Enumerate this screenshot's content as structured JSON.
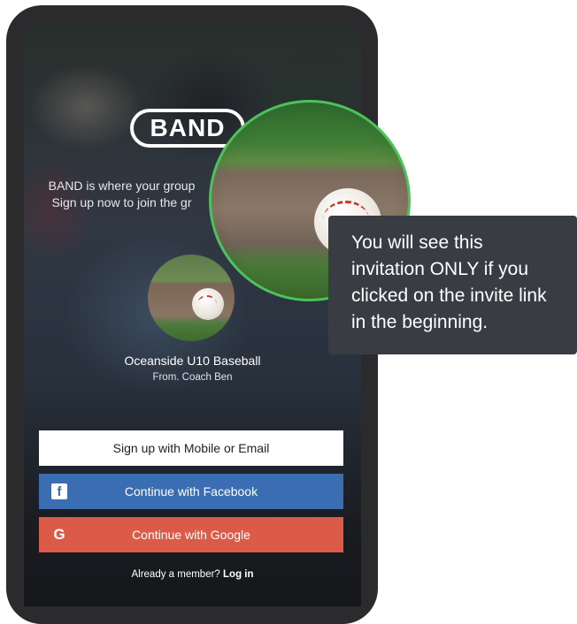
{
  "app": {
    "logo_text": "BAND"
  },
  "intro": {
    "line1": "BAND is where your group",
    "line2": "Sign up now to join the gr"
  },
  "invitation": {
    "group_name": "Oceanside U10 Baseball",
    "from": "From. Coach Ben"
  },
  "buttons": {
    "signup": "Sign up with Mobile or Email",
    "facebook": "Continue with Facebook",
    "google": "Continue with Google"
  },
  "icons": {
    "facebook": "f",
    "google": "G"
  },
  "login": {
    "prompt": "Already a member?",
    "link": "Log in"
  },
  "tooltip": {
    "text": "You will see this invitation ONLY if you clicked on the invite link in the beginning."
  },
  "colors": {
    "facebook": "#3b6db3",
    "google": "#dc5a48",
    "magnifier_ring": "#4cc25a",
    "tooltip_bg": "#3a3c44"
  }
}
